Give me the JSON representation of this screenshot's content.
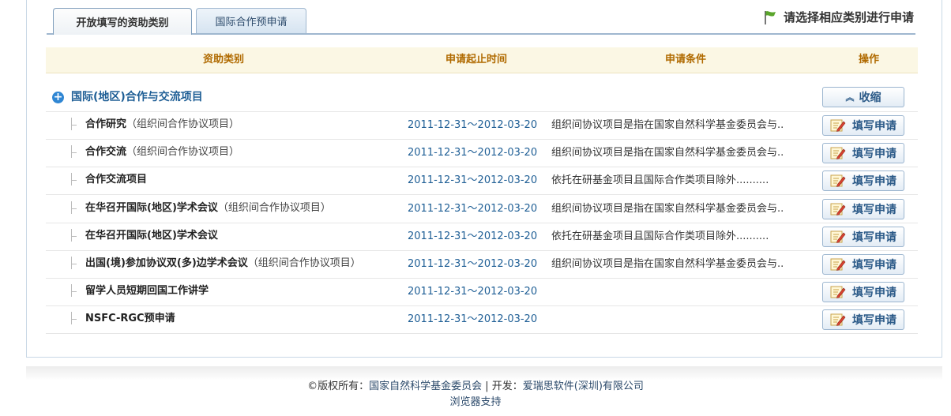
{
  "tabs": [
    {
      "label": "开放填写的资助类别"
    },
    {
      "label": "国际合作预申请"
    }
  ],
  "hint": "请选择相应类别进行申请",
  "columns": {
    "category": "资助类别",
    "period": "申请起止时间",
    "condition": "申请条件",
    "action": "操作"
  },
  "group": {
    "title": "国际(地区)合作与交流项目",
    "collapse_label": "收缩"
  },
  "fill_label": "填写申请",
  "rows": [
    {
      "name": "合作研究",
      "note": "（组织间合作协议项目）",
      "period": "2011-12-31～2012-03-20",
      "condition": "组织间协议项目是指在国家自然科学基金委员会与.."
    },
    {
      "name": "合作交流",
      "note": "（组织间合作协议项目）",
      "period": "2011-12-31～2012-03-20",
      "condition": "组织间协议项目是指在国家自然科学基金委员会与.."
    },
    {
      "name": "合作交流项目",
      "note": "",
      "period": "2011-12-31～2012-03-20",
      "condition": "依托在研基金项目且国际合作类项目除外.........."
    },
    {
      "name": "在华召开国际(地区)学术会议",
      "note": "（组织间合作协议项目）",
      "period": "2011-12-31～2012-03-20",
      "condition": "组织间协议项目是指在国家自然科学基金委员会与.."
    },
    {
      "name": "在华召开国际(地区)学术会议",
      "note": "",
      "period": "2011-12-31～2012-03-20",
      "condition": "依托在研基金项目且国际合作类项目除外.........."
    },
    {
      "name": "出国(境)参加协议双(多)边学术会议",
      "note": "（组织间合作协议项目）",
      "period": "2011-12-31～2012-03-20",
      "condition": "组织间协议项目是指在国家自然科学基金委员会与.."
    },
    {
      "name": "留学人员短期回国工作讲学",
      "note": "",
      "period": "2011-12-31～2012-03-20",
      "condition": ""
    },
    {
      "name": "NSFC-RGC预申请",
      "note": "",
      "period": "2011-12-31～2012-03-20",
      "condition": ""
    }
  ],
  "footer": {
    "copyright_prefix": "©版权所有：",
    "owner": "国家自然科学基金委员会",
    "separator": " | 开发：",
    "developer": "爱瑞思软件(深圳)有限公司",
    "browser_support": "浏览器支持"
  }
}
